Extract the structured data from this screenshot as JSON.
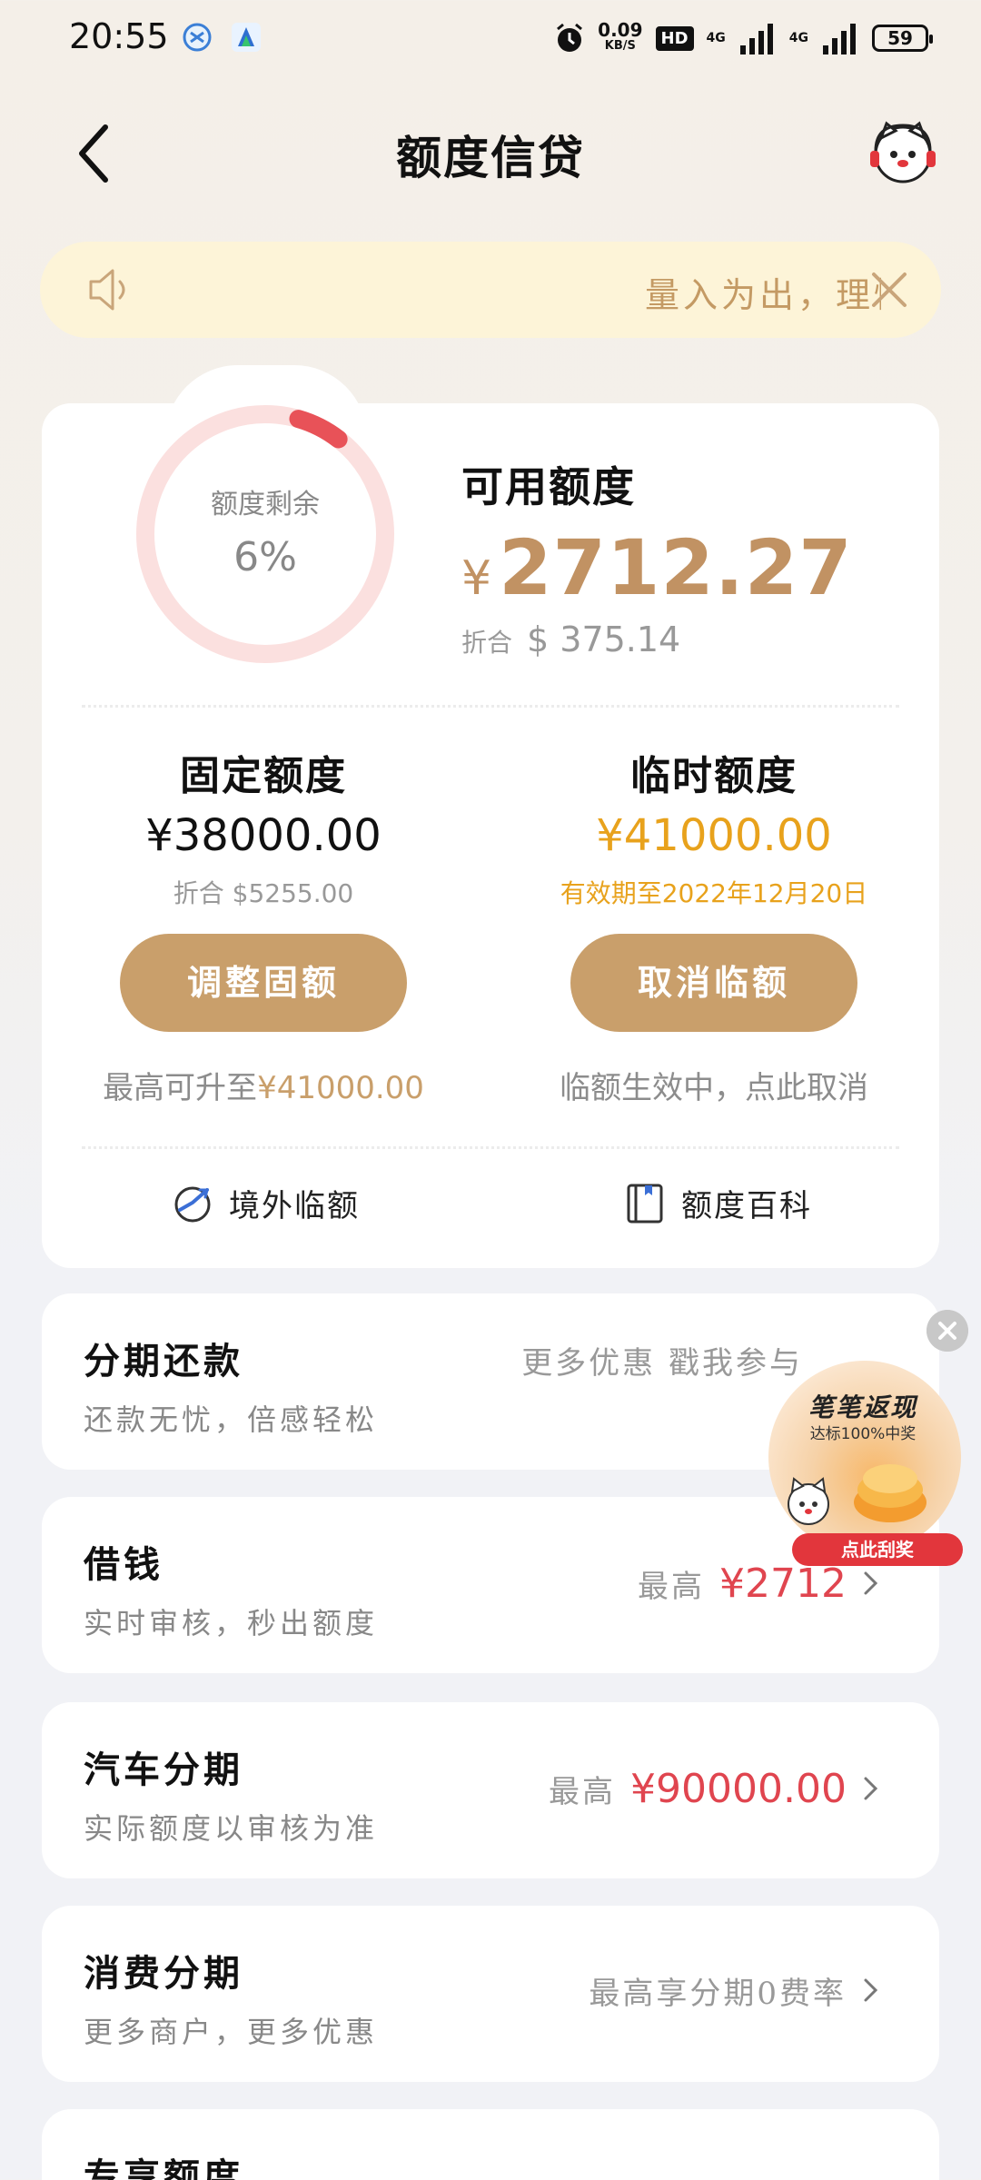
{
  "status_bar": {
    "time": "20:55",
    "speed_value": "0.09",
    "speed_unit": "KB/S",
    "hd_badge": "HD",
    "net1": "4G",
    "net2": "4G",
    "battery": "59"
  },
  "nav": {
    "title": "额度信贷",
    "back_icon": "chevron-left-icon",
    "service_icon": "customer-service-mascot-icon"
  },
  "notice": {
    "text": "量入为出，理性消费",
    "icon": "speaker-icon",
    "close_icon": "close-icon"
  },
  "credit": {
    "ring_label": "额度剩余",
    "ring_percent_text": "6%",
    "ring_fraction": 0.06,
    "available_label": "可用额度",
    "currency_symbol": "¥",
    "available_amount": "2712.27",
    "converted_label": "折合",
    "converted_amount": "$ 375.14",
    "fixed": {
      "title": "固定额度",
      "amount": "¥38000.00",
      "sub": "折合 $5255.00",
      "button": "调整固额",
      "note_prefix": "最高可升至",
      "note_value": "¥41000.00"
    },
    "temp": {
      "title": "临时额度",
      "amount": "¥41000.00",
      "sub": "有效期至2022年12月20日",
      "button": "取消临额",
      "note": "临额生效中，点此取消"
    },
    "links": [
      {
        "label": "境外临额",
        "icon": "overseas-plane-icon"
      },
      {
        "label": "额度百科",
        "icon": "book-icon"
      }
    ]
  },
  "list": [
    {
      "title": "分期还款",
      "sub": "还款无忧，倍感轻松",
      "right_text": "更多优惠 戳我参与"
    },
    {
      "title": "借钱",
      "sub": "实时审核，秒出额度",
      "prefix": "最高",
      "value": "¥2712"
    },
    {
      "title": "汽车分期",
      "sub": "实际额度以审核为准",
      "prefix": "最高",
      "value": "¥90000.00"
    },
    {
      "title": "消费分期",
      "sub": "更多商户，更多优惠",
      "right_text": "最高享分期0费率"
    },
    {
      "title": "专享额度"
    }
  ],
  "promo": {
    "title": "笔笔返现",
    "sub": "达标100%中奖",
    "button": "点此刮奖"
  },
  "colors": {
    "gold": "#c99f6b",
    "accent_gold": "#e8a21c",
    "red": "#e0454f",
    "ring_track": "#fbe0df",
    "ring_fill": "#e85258"
  }
}
